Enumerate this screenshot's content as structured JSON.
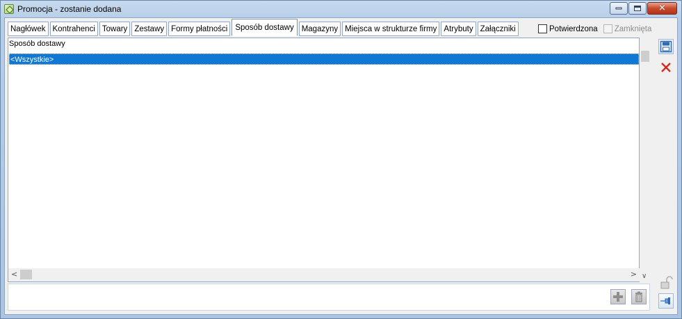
{
  "window": {
    "title": "Promocja - zostanie dodana"
  },
  "tabs": [
    {
      "label": "Nagłówek",
      "active": false
    },
    {
      "label": "Kontrahenci",
      "active": false
    },
    {
      "label": "Towary",
      "active": false
    },
    {
      "label": "Zestawy",
      "active": false
    },
    {
      "label": "Formy płatności",
      "active": false
    },
    {
      "label": "Sposób dostawy",
      "active": true
    },
    {
      "label": "Magazyny",
      "active": false
    },
    {
      "label": "Miejsca w strukturze firmy",
      "active": false
    },
    {
      "label": "Atrybuty",
      "active": false
    },
    {
      "label": "Załączniki",
      "active": false
    }
  ],
  "checkboxes": {
    "confirmed_label": "Potwierdzona",
    "confirmed_checked": false,
    "closed_label": "Zamknięta",
    "closed_checked": false
  },
  "grid": {
    "column_header": "Sposób dostawy",
    "rows": [
      {
        "value": "<Wszystkie>",
        "selected": true
      }
    ]
  },
  "icons": {
    "save": "floppy-disk-icon",
    "cancel": "red-x-icon",
    "add": "plus-icon",
    "delete": "trash-icon",
    "lock": "padlock-icon",
    "pin": "pushpin-icon"
  },
  "colors": {
    "selection": "#0f78d4",
    "cancel_red": "#d8261b",
    "save_blue": "#2f69b5"
  }
}
